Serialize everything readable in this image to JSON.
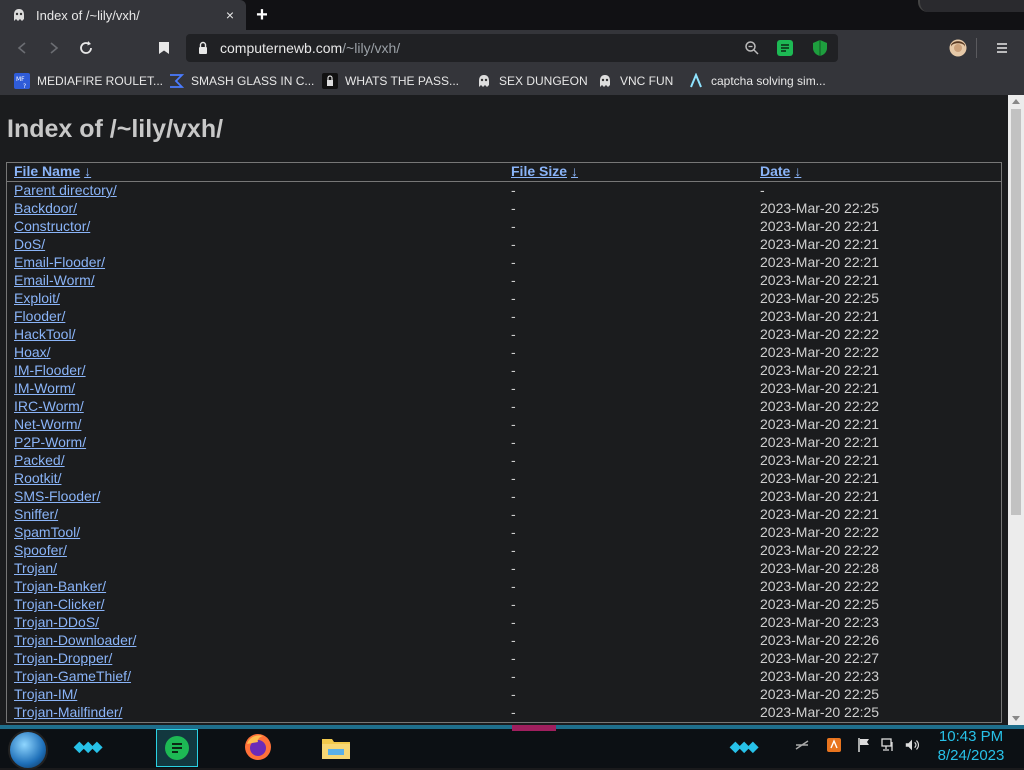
{
  "browser": {
    "tab_title": "Index of /~lily/vxh/",
    "tab_close": "×",
    "new_tab": "+",
    "url_domain": "computernewb.com",
    "url_path": "/~lily/vxh/"
  },
  "bookmarks": [
    {
      "label": "MEDIAFIRE ROULET...",
      "icon": "mediafire-icon"
    },
    {
      "label": "SMASH GLASS IN C...",
      "icon": "sigma-icon"
    },
    {
      "label": "WHATS THE PASS...",
      "icon": "lock-icon"
    },
    {
      "label": "SEX DUNGEON",
      "icon": "ghost-icon"
    },
    {
      "label": "VNC FUN",
      "icon": "ghost-icon"
    },
    {
      "label": "captcha solving sim...",
      "icon": "lambda-icon"
    }
  ],
  "page": {
    "heading": "Index of /~lily/vxh/",
    "columns": {
      "name": "File Name",
      "size": "File Size",
      "date": "Date",
      "arrow": "↓"
    },
    "rows": [
      {
        "name": "Parent directory/",
        "size": "-",
        "date": "-"
      },
      {
        "name": "Backdoor/",
        "size": "-",
        "date": "2023-Mar-20 22:25"
      },
      {
        "name": "Constructor/",
        "size": "-",
        "date": "2023-Mar-20 22:21"
      },
      {
        "name": "DoS/",
        "size": "-",
        "date": "2023-Mar-20 22:21"
      },
      {
        "name": "Email-Flooder/",
        "size": "-",
        "date": "2023-Mar-20 22:21"
      },
      {
        "name": "Email-Worm/",
        "size": "-",
        "date": "2023-Mar-20 22:21"
      },
      {
        "name": "Exploit/",
        "size": "-",
        "date": "2023-Mar-20 22:25"
      },
      {
        "name": "Flooder/",
        "size": "-",
        "date": "2023-Mar-20 22:21"
      },
      {
        "name": "HackTool/",
        "size": "-",
        "date": "2023-Mar-20 22:22"
      },
      {
        "name": "Hoax/",
        "size": "-",
        "date": "2023-Mar-20 22:22"
      },
      {
        "name": "IM-Flooder/",
        "size": "-",
        "date": "2023-Mar-20 22:21"
      },
      {
        "name": "IM-Worm/",
        "size": "-",
        "date": "2023-Mar-20 22:21"
      },
      {
        "name": "IRC-Worm/",
        "size": "-",
        "date": "2023-Mar-20 22:22"
      },
      {
        "name": "Net-Worm/",
        "size": "-",
        "date": "2023-Mar-20 22:21"
      },
      {
        "name": "P2P-Worm/",
        "size": "-",
        "date": "2023-Mar-20 22:21"
      },
      {
        "name": "Packed/",
        "size": "-",
        "date": "2023-Mar-20 22:21"
      },
      {
        "name": "Rootkit/",
        "size": "-",
        "date": "2023-Mar-20 22:21"
      },
      {
        "name": "SMS-Flooder/",
        "size": "-",
        "date": "2023-Mar-20 22:21"
      },
      {
        "name": "Sniffer/",
        "size": "-",
        "date": "2023-Mar-20 22:21"
      },
      {
        "name": "SpamTool/",
        "size": "-",
        "date": "2023-Mar-20 22:22"
      },
      {
        "name": "Spoofer/",
        "size": "-",
        "date": "2023-Mar-20 22:22"
      },
      {
        "name": "Trojan/",
        "size": "-",
        "date": "2023-Mar-20 22:28"
      },
      {
        "name": "Trojan-Banker/",
        "size": "-",
        "date": "2023-Mar-20 22:22"
      },
      {
        "name": "Trojan-Clicker/",
        "size": "-",
        "date": "2023-Mar-20 22:25"
      },
      {
        "name": "Trojan-DDoS/",
        "size": "-",
        "date": "2023-Mar-20 22:23"
      },
      {
        "name": "Trojan-Downloader/",
        "size": "-",
        "date": "2023-Mar-20 22:26"
      },
      {
        "name": "Trojan-Dropper/",
        "size": "-",
        "date": "2023-Mar-20 22:27"
      },
      {
        "name": "Trojan-GameThief/",
        "size": "-",
        "date": "2023-Mar-20 22:23"
      },
      {
        "name": "Trojan-IM/",
        "size": "-",
        "date": "2023-Mar-20 22:25"
      },
      {
        "name": "Trojan-Mailfinder/",
        "size": "-",
        "date": "2023-Mar-20 22:25"
      }
    ]
  },
  "taskbar": {
    "time": "10:43 PM",
    "date": "8/24/2023",
    "apps": [
      "notes-app-icon",
      "firefox-icon",
      "file-explorer-icon"
    ]
  },
  "colors": {
    "link": "#8ab4f8",
    "page_bg": "#1b1c1e",
    "accent": "#27c1e8"
  }
}
